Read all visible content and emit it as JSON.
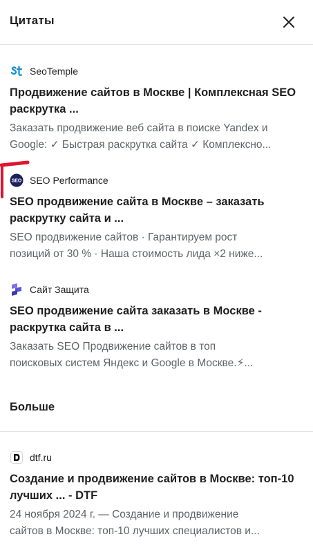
{
  "header": {
    "title": "Цитаты",
    "close_icon": "close-icon"
  },
  "citations": [
    {
      "source": "SeoTemple",
      "icon": "seotemple-favicon",
      "title": "Продвижение сайтов в Москве | Комплексная SEO\nраскрутка ...",
      "snippet": "Заказать продвижение веб сайта в поиске Yandex и\nGoogle: ✓ Быстрая раскрутка сайта ✓ Комплексно..."
    },
    {
      "source": "SEO Performance",
      "icon": "seo-performance-favicon",
      "title": "SEO продвижение сайта в Москве – заказать\nраскрутку сайта и ...",
      "snippet": "SEO продвижение сайтов · Гарантируем рост\nпозиций от 30 % · Наша стоимость лида ×2 ниже..."
    },
    {
      "source": "Сайт Защита",
      "icon": "sait-zashita-favicon",
      "title": "SEO продвижение сайта заказать в Москве -\nраскрутка сайта в ...",
      "snippet": "Заказать SEO Продвижение сайтов в топ\nпоисковых систем Яндекс и Google в Москве.⚡..."
    }
  ],
  "more": {
    "heading": "Больше",
    "items": [
      {
        "source": "dtf.ru",
        "icon": "dtf-favicon",
        "title": "Создание и продвижение сайтов в Москве: топ-10\nлучших ... - DTF",
        "snippet": "24 ноября 2024 г. — Создание и продвижение\nсайтов в Москве: топ-10 лучших специалистов и..."
      }
    ]
  },
  "colors": {
    "text": "#1f1f1f",
    "snippet": "#5f6368",
    "divider": "#e3e3e3",
    "seotemple": "#1a8fd6",
    "seo_performance": "#1b1f5e",
    "sait_zashita": "#5b54d6",
    "red_mark": "#e0142e"
  }
}
